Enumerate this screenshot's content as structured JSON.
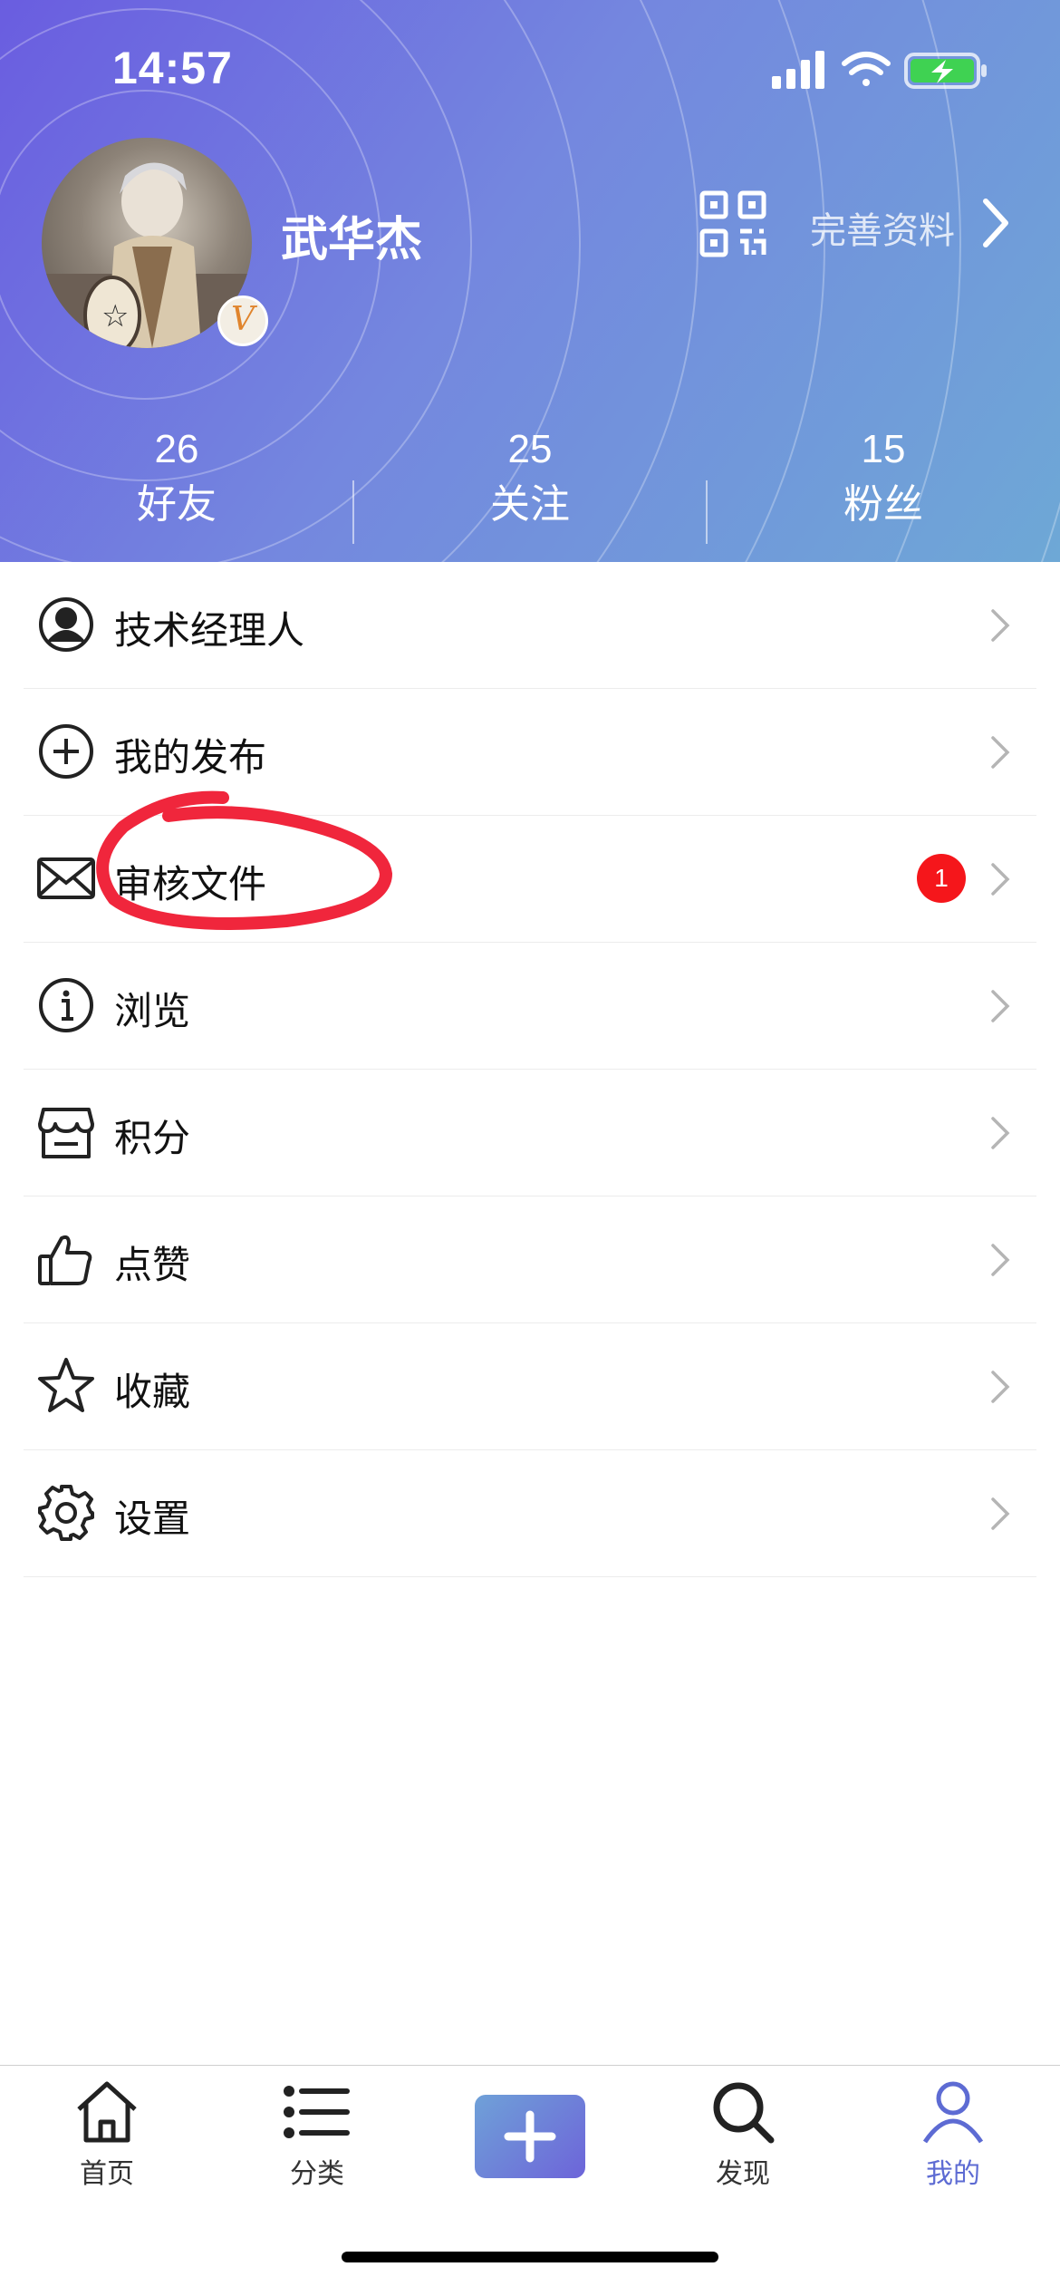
{
  "status_bar": {
    "time": "14:57"
  },
  "profile": {
    "name": "武华杰",
    "badge_letter": "V",
    "edit_label": "完善资料",
    "icons": {
      "qr": "qr-code-icon",
      "chevron": "chevron-right-icon"
    }
  },
  "stats": [
    {
      "value": "26",
      "label": "好友"
    },
    {
      "value": "25",
      "label": "关注"
    },
    {
      "value": "15",
      "label": "粉丝"
    }
  ],
  "menu": [
    {
      "label": "技术经理人",
      "icon": "user-circle-icon"
    },
    {
      "label": "我的发布",
      "icon": "plus-circle-icon"
    },
    {
      "label": "审核文件",
      "icon": "mail-icon",
      "badge": "1",
      "annotated": true,
      "annotation_color": "#f0263c"
    },
    {
      "label": "浏览",
      "icon": "info-icon"
    },
    {
      "label": "积分",
      "icon": "store-icon"
    },
    {
      "label": "点赞",
      "icon": "thumbs-up-icon"
    },
    {
      "label": "收藏",
      "icon": "star-icon"
    },
    {
      "label": "设置",
      "icon": "gear-icon"
    }
  ],
  "tabbar": [
    {
      "label": "首页",
      "icon": "home-icon"
    },
    {
      "label": "分类",
      "icon": "list-icon"
    },
    {
      "label": "",
      "icon": "plus-icon"
    },
    {
      "label": "发现",
      "icon": "search-icon"
    },
    {
      "label": "我的",
      "icon": "user-icon",
      "active": true
    }
  ],
  "colors": {
    "header_gradient_start": "#6a5de0",
    "header_gradient_end": "#6ea8d6",
    "badge_red": "#f5161b",
    "active_tab": "#5d6bd3"
  }
}
